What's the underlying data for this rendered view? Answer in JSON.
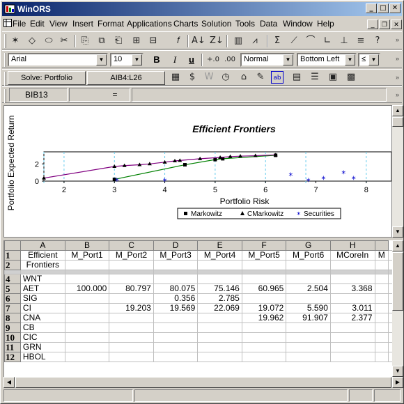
{
  "window": {
    "title": "WinORS"
  },
  "title_buttons": {
    "minimize": "_",
    "maximize": "□",
    "close": "✕"
  },
  "menu": [
    "File",
    "Edit",
    "View",
    "Insert",
    "Format",
    "Applications",
    "Charts",
    "Solution",
    "Tools",
    "Data",
    "Window",
    "Help"
  ],
  "toolbar1_icons": [
    "new-icon",
    "open-icon",
    "save-icon",
    "cut-icon",
    "copy-icon",
    "paste-icon",
    "fill-icon",
    "function-icon",
    "sort-ascending-icon",
    "sort-descending-icon",
    "bar-chart-icon",
    "line-chart-icon",
    "sum-icon",
    "chart-a-icon",
    "chart-b-icon",
    "chart-c-icon",
    "chart-d-icon",
    "help-icon"
  ],
  "format_bar": {
    "font": "Arial",
    "size": "10",
    "bold": "B",
    "italic": "I",
    "underline": "u",
    "style": "Normal",
    "align": "Bottom Left",
    "operator": "≤"
  },
  "solver_bar": {
    "solve_label": "Solve: Portfolio",
    "range": "AIB4:L26"
  },
  "cell_ref": "BIB13",
  "formula_eq": "=",
  "formula_value": "",
  "chart": {
    "title": "Efficient Frontiers",
    "xlabel": "Portfolio Risk",
    "ylabel": "Portfolio Expected Return",
    "x_ticks": [
      "2",
      "3",
      "4",
      "5",
      "6",
      "7",
      "8"
    ],
    "y_ticks": [
      "0",
      "2"
    ],
    "legend": [
      "Markowitz",
      "CMarkowitz",
      "Securities"
    ]
  },
  "chart_data": {
    "type": "scatter",
    "title": "Efficient Frontiers",
    "xlabel": "Portfolio Risk",
    "ylabel": "Portfolio Expected Return",
    "xlim": [
      1.6,
      8.5
    ],
    "ylim": [
      0,
      3.4
    ],
    "legend_position": "bottom",
    "grid": false,
    "series": [
      {
        "name": "Markowitz",
        "marker": "square",
        "color": "#008000",
        "points": [
          [
            3.0,
            0.2
          ],
          [
            4.4,
            1.9
          ],
          [
            5.0,
            2.5
          ],
          [
            5.15,
            2.6
          ],
          [
            6.2,
            3.0
          ]
        ]
      },
      {
        "name": "CMarkowitz",
        "marker": "triangle",
        "color": "#800080",
        "points": [
          [
            1.6,
            0.35
          ],
          [
            3.0,
            1.7
          ],
          [
            3.2,
            1.8
          ],
          [
            3.5,
            1.9
          ],
          [
            3.7,
            2.0
          ],
          [
            4.0,
            2.2
          ],
          [
            4.2,
            2.35
          ],
          [
            4.3,
            2.4
          ],
          [
            4.7,
            2.6
          ],
          [
            5.1,
            2.75
          ],
          [
            5.3,
            2.85
          ],
          [
            5.5,
            2.9
          ],
          [
            5.8,
            2.95
          ],
          [
            6.2,
            3.05
          ]
        ]
      },
      {
        "name": "Securities",
        "marker": "star",
        "color": "#0000cc",
        "points": [
          [
            3.05,
            0.1
          ],
          [
            4.0,
            0.05
          ],
          [
            6.5,
            0.7
          ],
          [
            6.85,
            0.05
          ],
          [
            7.15,
            0.3
          ],
          [
            7.55,
            0.95
          ],
          [
            7.75,
            0.3
          ]
        ]
      }
    ]
  },
  "sheet": {
    "columns": [
      "A",
      "B",
      "C",
      "D",
      "E",
      "F",
      "G",
      "H",
      ""
    ],
    "rows": [
      {
        "num": "1",
        "cells": [
          "Efficient",
          "M_Port1",
          "M_Port2",
          "M_Port3",
          "M_Port4",
          "M_Port5",
          "M_Port6",
          "MCoreIn",
          "M"
        ]
      },
      {
        "num": "2",
        "cells": [
          "Frontiers",
          "",
          "",
          "",
          "",
          "",
          "",
          "",
          ""
        ]
      },
      {
        "num": "4",
        "cells": [
          "WNT",
          "",
          "",
          "",
          "",
          "",
          "",
          "",
          ""
        ]
      },
      {
        "num": "5",
        "cells": [
          "AET",
          "100.000",
          "80.797",
          "80.075",
          "75.146",
          "60.965",
          "2.504",
          "3.368",
          ""
        ]
      },
      {
        "num": "6",
        "cells": [
          "SIG",
          "",
          "",
          "0.356",
          "2.785",
          "",
          "",
          "",
          ""
        ]
      },
      {
        "num": "7",
        "cells": [
          "CI",
          "",
          "19.203",
          "19.569",
          "22.069",
          "19.072",
          "5.590",
          "3.011",
          ""
        ]
      },
      {
        "num": "8",
        "cells": [
          "CNA",
          "",
          "",
          "",
          "",
          "19.962",
          "91.907",
          "2.377",
          ""
        ]
      },
      {
        "num": "9",
        "cells": [
          "CB",
          "",
          "",
          "",
          "",
          "",
          "",
          "",
          ""
        ]
      },
      {
        "num": "10",
        "cells": [
          "CIC",
          "",
          "",
          "",
          "",
          "",
          "",
          "",
          ""
        ]
      },
      {
        "num": "11",
        "cells": [
          "GRN",
          "",
          "",
          "",
          "",
          "",
          "",
          "",
          ""
        ]
      },
      {
        "num": "12",
        "cells": [
          "HBOL",
          "",
          "",
          "",
          "",
          "",
          "",
          "",
          ""
        ]
      }
    ]
  },
  "colors": {
    "titlebar_start": "#0a246a",
    "titlebar_end": "#a6caf0",
    "face": "#d4d0c8",
    "markowitz": "#008000",
    "cmarkowitz": "#800080",
    "securities": "#0000cc"
  }
}
